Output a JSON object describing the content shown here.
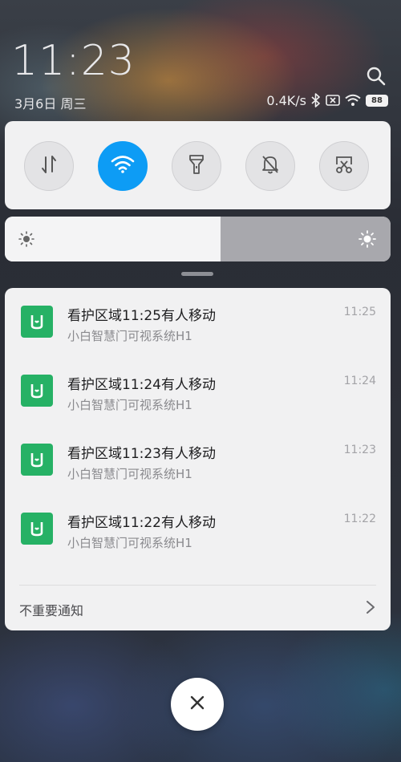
{
  "status": {
    "time": "11:23",
    "date": "3月6日 周三",
    "net_speed": "0.4K/s",
    "battery": "88"
  },
  "icons": {
    "search": "search-icon",
    "bluetooth": "bluetooth-icon",
    "sim": "no-sim-icon",
    "wifi_status": "wifi-icon",
    "battery": "battery-icon"
  },
  "toggles": [
    {
      "name": "mobile-data",
      "icon": "data-arrows-icon",
      "active": false
    },
    {
      "name": "wifi",
      "icon": "wifi-icon",
      "active": true
    },
    {
      "name": "flashlight",
      "icon": "flashlight-icon",
      "active": false
    },
    {
      "name": "silent",
      "icon": "bell-off-icon",
      "active": false
    },
    {
      "name": "screenshot",
      "icon": "scissors-icon",
      "active": false
    }
  ],
  "brightness": {
    "level": 0.56
  },
  "notifications": [
    {
      "title": "看护区域11:25有人移动",
      "subtitle": "小白智慧门可视系统H1",
      "time": "11:25"
    },
    {
      "title": "看护区域11:24有人移动",
      "subtitle": "小白智慧门可视系统H1",
      "time": "11:24"
    },
    {
      "title": "看护区域11:23有人移动",
      "subtitle": "小白智慧门可视系统H1",
      "time": "11:23"
    },
    {
      "title": "看护区域11:22有人移动",
      "subtitle": "小白智慧门可视系统H1",
      "time": "11:22"
    }
  ],
  "footer": {
    "label": "不重要通知"
  },
  "colors": {
    "accent": "#0d9cf5",
    "app_icon": "#26b165"
  }
}
